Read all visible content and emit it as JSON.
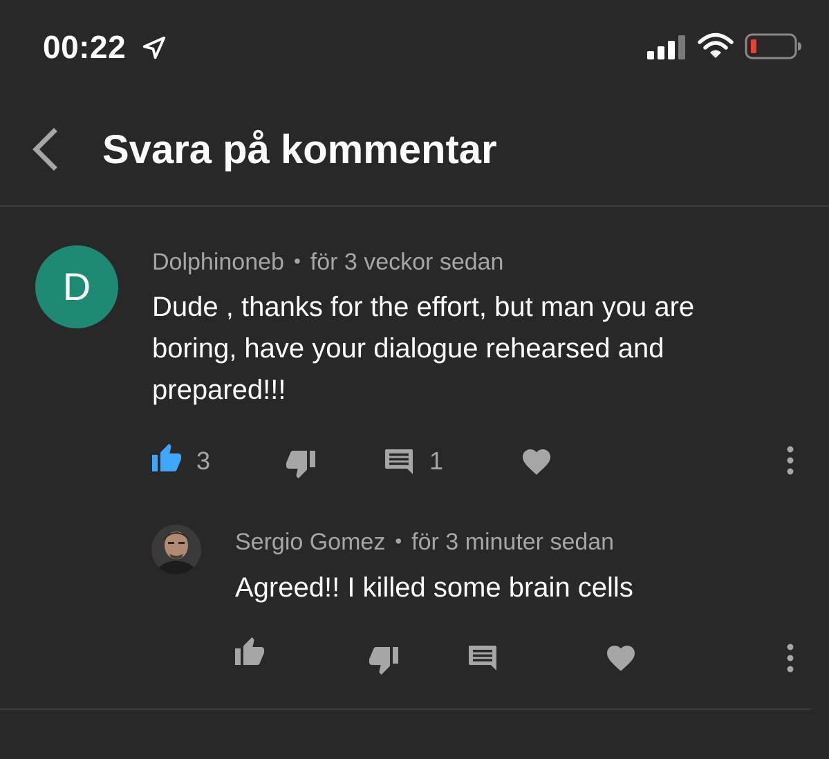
{
  "status_bar": {
    "time": "00:22",
    "icons": [
      "location-arrow-icon",
      "cell-signal-icon",
      "wifi-icon",
      "battery-low-icon"
    ],
    "battery_color": "#ff3b30"
  },
  "header": {
    "title": "Svara på kommentar",
    "back_icon": "chevron-left-icon"
  },
  "comment": {
    "avatar_letter": "D",
    "avatar_color": "#1f8a74",
    "author": "Dolphinoneb",
    "separator": "•",
    "time": "för 3 veckor sedan",
    "text": "Dude , thanks for the effort, but man you are boring, have your dialogue rehearsed and prepared!!!",
    "like_count": "3",
    "reply_count": "1",
    "liked": true,
    "like_color": "#3ea6ff"
  },
  "reply": {
    "author": "Sergio Gomez",
    "separator": "•",
    "time": "för 3 minuter sedan",
    "text": "Agreed!! I killed some brain cells"
  }
}
